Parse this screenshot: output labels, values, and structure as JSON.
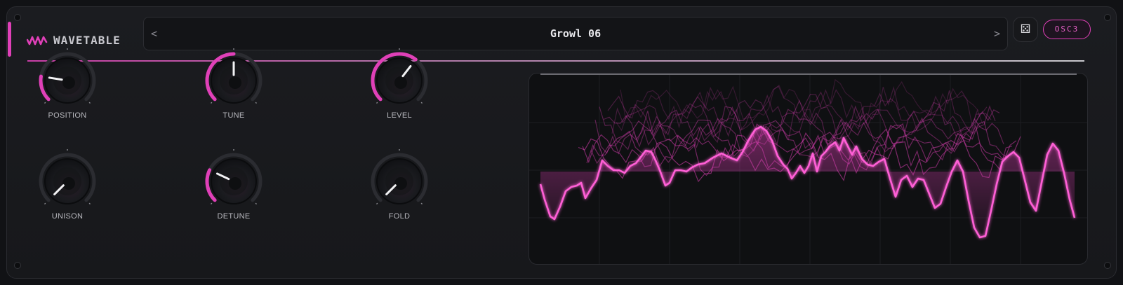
{
  "header": {
    "title": "WAVETABLE",
    "preset_prev": "<",
    "preset_name": "Growl 06",
    "preset_next": ">",
    "dice_icon": "⚄",
    "osc_label": "OSC3"
  },
  "colors": {
    "accent": "#e040b8",
    "accent_glow": "#ff5fd6",
    "panel": "#1b1c20",
    "display_bg": "#0f1012"
  },
  "knobs": [
    {
      "id": "position",
      "label": "POSITION",
      "value": 0.2
    },
    {
      "id": "tune",
      "label": "TUNE",
      "value": 0.5
    },
    {
      "id": "level",
      "label": "LEVEL",
      "value": 0.64
    },
    {
      "id": "unison",
      "label": "UNISON",
      "value": 0.0
    },
    {
      "id": "detune",
      "label": "DETUNE",
      "value": 0.26
    },
    {
      "id": "fold",
      "label": "FOLD",
      "value": 0.0
    }
  ]
}
